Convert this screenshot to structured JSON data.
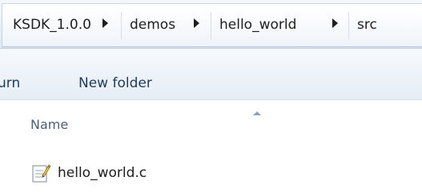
{
  "breadcrumb": {
    "items": [
      "KSDK_1.0.0",
      "demos",
      "hello_world",
      "src"
    ]
  },
  "toolbar": {
    "partial_label": "urn",
    "new_folder_label": "New folder"
  },
  "columns": {
    "name_label": "Name"
  },
  "files": [
    {
      "name": "hello_world.c",
      "icon": "c-source-file-icon"
    }
  ]
}
